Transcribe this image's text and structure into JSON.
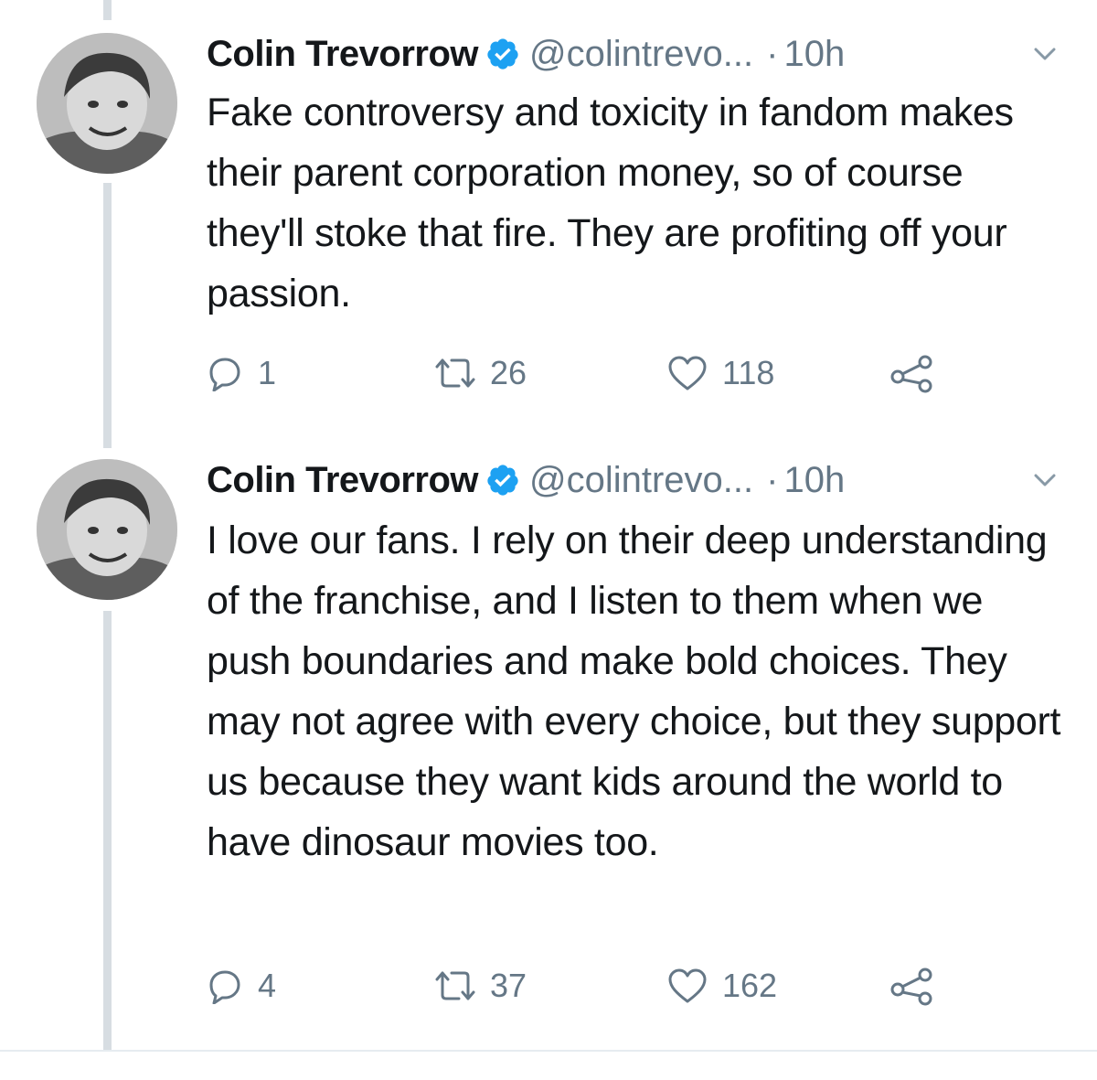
{
  "colors": {
    "verified_badge": "#1da1f2",
    "secondary_text": "#657786",
    "thread_line": "#d7dde2"
  },
  "tweets": [
    {
      "author": {
        "name": "Colin Trevorrow",
        "handle": "@colintrevo...",
        "verified": true
      },
      "separator": "·",
      "time": "10h",
      "text": "Fake controversy and toxicity in fandom makes their parent corporation money, so of course they'll stoke that fire. They are profiting off your passion.",
      "actions": {
        "replies": "1",
        "retweets": "26",
        "likes": "118"
      },
      "icons": [
        "reply-icon",
        "retweet-icon",
        "like-icon",
        "share-icon"
      ]
    },
    {
      "author": {
        "name": "Colin Trevorrow",
        "handle": "@colintrevo...",
        "verified": true
      },
      "separator": "·",
      "time": "10h",
      "text": "I love our fans. I rely on their deep understanding of the franchise, and I listen to them when we push boundaries and make bold choices. They may not agree with every choice, but they support us because they want kids around the world to have dinosaur movies too.",
      "actions": {
        "replies": "4",
        "retweets": "37",
        "likes": "162"
      },
      "icons": [
        "reply-icon",
        "retweet-icon",
        "like-icon",
        "share-icon"
      ]
    }
  ]
}
